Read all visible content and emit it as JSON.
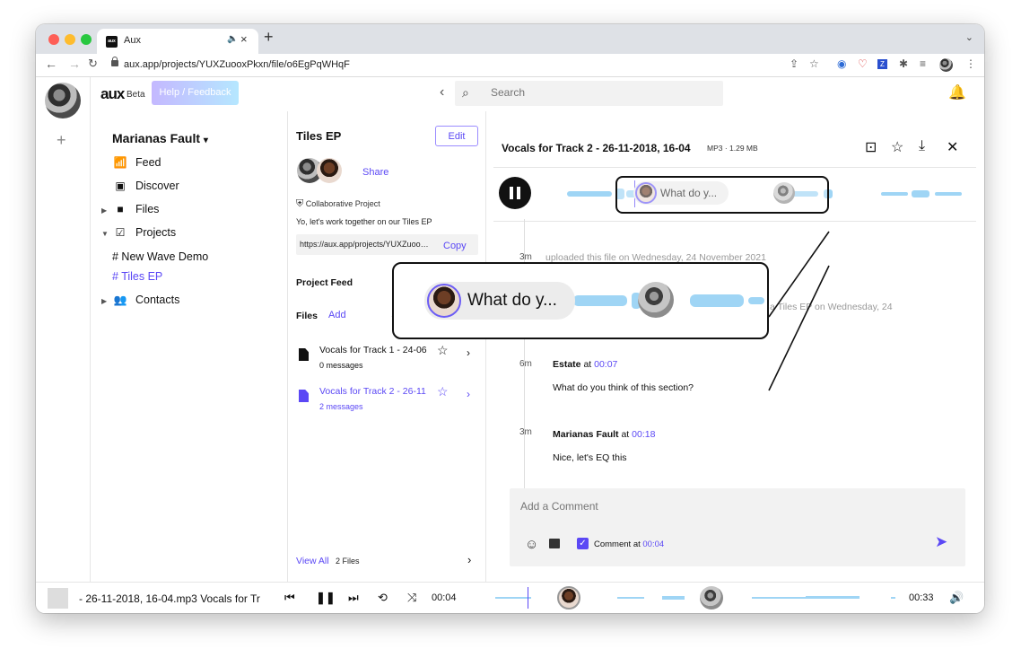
{
  "browser": {
    "tab_title": "Aux",
    "favicon_text": "aux",
    "url": "aux.app/projects/YUXZuooxPkxn/file/o6EgPqWHqF"
  },
  "header": {
    "logo": "aux",
    "beta": "Beta",
    "help_label": "Help / Feedback",
    "search_placeholder": "Search"
  },
  "sidebar": {
    "workspace": "Marianas Fault",
    "items": [
      {
        "label": "Feed"
      },
      {
        "label": "Discover"
      },
      {
        "label": "Files"
      },
      {
        "label": "Projects"
      }
    ],
    "channels": [
      "# New Wave Demo",
      "# Tiles EP"
    ],
    "contacts": "Contacts"
  },
  "project": {
    "title": "Tiles EP",
    "edit_label": "Edit",
    "share_label": "Share",
    "collab_label": "Collaborative Project",
    "description": "Yo, let's work together on our Tiles EP",
    "link": "https://aux.app/projects/YUXZuooxPkxn",
    "copy_label": "Copy",
    "feed_label": "Project Feed",
    "files_label": "Files",
    "add_label": "Add",
    "files": [
      {
        "name": "Vocals for Track 1 - 24-06",
        "messages": "0 messages"
      },
      {
        "name": "Vocals for Track 2 - 26-11",
        "messages": "2 messages"
      }
    ],
    "view_all": "View All",
    "file_count": "2 Files"
  },
  "detail": {
    "title": "Vocals for Track 2 - 26-11-2018, 16-04",
    "meta": "MP3 · 1.29 MB",
    "bubble_text": "What do y...",
    "activity": [
      {
        "ago": "3m",
        "text": "uploaded this file on Wednesday, 24 November 2021"
      },
      {
        "ago": "",
        "text": "a Tiles EP on Wednesday, 24"
      }
    ],
    "comments": [
      {
        "ago": "6m",
        "author": "Estate",
        "at": "at",
        "time": "00:07",
        "body": "What do you think of this section?"
      },
      {
        "ago": "3m",
        "author": "Marianas Fault",
        "at": "at",
        "time": "00:18",
        "body": "Nice, let's EQ this"
      }
    ],
    "comment_placeholder": "Add a Comment",
    "comment_at_label": "Comment at",
    "comment_at_time": "00:04"
  },
  "player": {
    "track": "- 26-11-2018, 16-04.mp3   Vocals for Tr",
    "current": "00:04",
    "total": "00:33"
  },
  "colors": {
    "accent": "#5b48f5",
    "wave": "#9fd5f5"
  }
}
